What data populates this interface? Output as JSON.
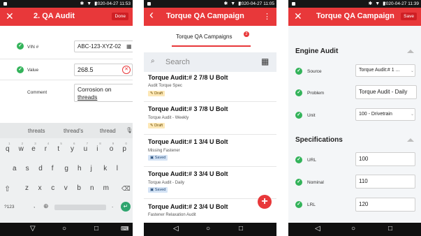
{
  "status": {
    "screen1_time": "2020-04-27 11:53",
    "screen2_time": "2020-04-27 11:05",
    "screen3_time": "2020-04-27 11:39",
    "icons": "✱ ▼ ▮"
  },
  "screen1": {
    "close_glyph": "✕",
    "title": "2. QA Audit",
    "done_label": "Done",
    "fields": [
      {
        "label": "VIN #",
        "value": "ABC-123-XYZ-02"
      },
      {
        "label": "Value",
        "value": "268.5"
      },
      {
        "label": "Comment",
        "value_line1": "Corrosion on",
        "value_line2": "threads"
      }
    ],
    "keyboard": {
      "suggestions": [
        "threats",
        "thread's",
        "thread"
      ],
      "row1": [
        "q",
        "w",
        "e",
        "r",
        "t",
        "y",
        "u",
        "i",
        "o",
        "p"
      ],
      "row1_hints": [
        "1",
        "2",
        "3",
        "4",
        "5",
        "6",
        "7",
        "8",
        "9",
        "0"
      ],
      "row2": [
        "a",
        "s",
        "d",
        "f",
        "g",
        "h",
        "j",
        "k",
        "l"
      ],
      "row3": [
        "z",
        "x",
        "c",
        "v",
        "b",
        "n",
        "m"
      ],
      "symbols_key": "?123",
      "comma_key": ",",
      "period_key": "."
    }
  },
  "screen2": {
    "back_glyph": "‹",
    "title": "Torque QA Campaign",
    "menu_glyph": "⋮",
    "tab_label": "Torque QA Campaigns",
    "tab_badge": "2",
    "search_placeholder": "Search",
    "fab_glyph": "+",
    "items": [
      {
        "title": "Torque Audit:# 2 7/8 U Bolt",
        "subtitle": "Audit Torque Spec",
        "badge": "✎ Draft",
        "status": "draft"
      },
      {
        "title": "Torque Audit:# 3 7/8 U Bolt",
        "subtitle": "Torque Audit - Weekly",
        "badge": "✎ Draft",
        "status": "draft"
      },
      {
        "title": "Torque Audit:# 1 3/4 U Bolt",
        "subtitle": "Missing Fastener",
        "badge": "▣ Saved",
        "status": "saved"
      },
      {
        "title": "Torque Audit:# 3 3/4 U Bolt",
        "subtitle": "Torque Audit - Daily",
        "badge": "▣ Saved",
        "status": "saved"
      },
      {
        "title": "Torque Audit:# 2 3/4 U Bolt",
        "subtitle": "Fastener Relaxation Audit",
        "badge": "",
        "status": ""
      }
    ]
  },
  "screen3": {
    "close_glyph": "✕",
    "title": "Torque QA Campaign",
    "save_label": "Save",
    "section1": "Engine Audit",
    "section2": "Specifications",
    "engine_fields": [
      {
        "label": "Source",
        "value": "Torque Audit:# 1 ..."
      },
      {
        "label": "Problem",
        "value": "Torque Audit - Daily"
      },
      {
        "label": "Unit",
        "value": "100 - Drivetrain"
      }
    ],
    "spec_fields": [
      {
        "label": "URL",
        "value": "100"
      },
      {
        "label": "Nominal",
        "value": "110"
      },
      {
        "label": "LRL",
        "value": "120"
      }
    ]
  },
  "colors": {
    "accent": "#e8383a",
    "check": "#33b35a",
    "draft": "#fde8b7",
    "saved": "#d4e3f5"
  }
}
